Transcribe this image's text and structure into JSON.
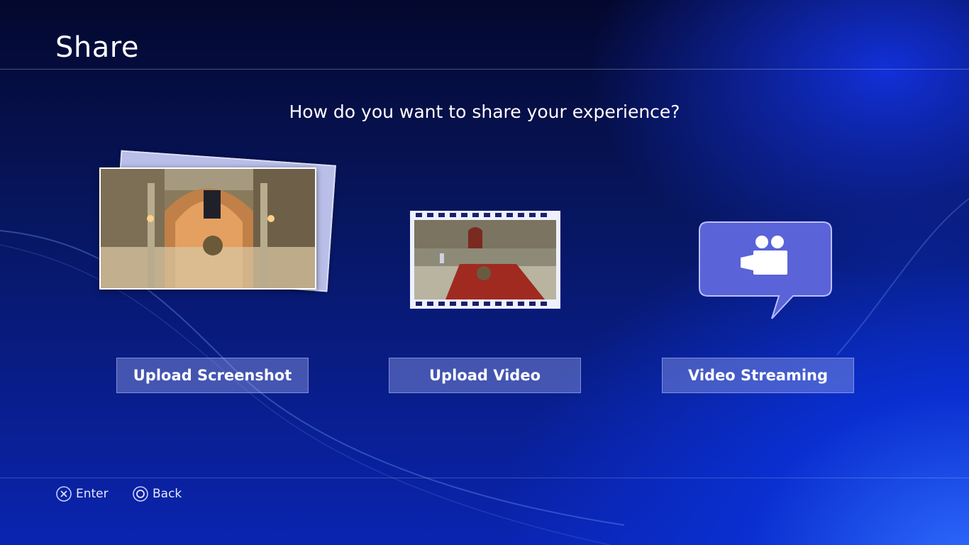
{
  "header": {
    "title": "Share"
  },
  "prompt": "How do you want to share your experience?",
  "options": [
    {
      "label": "Upload Screenshot",
      "icon": "screenshot-thumbnail"
    },
    {
      "label": "Upload Video",
      "icon": "video-film-thumbnail"
    },
    {
      "label": "Video Streaming",
      "icon": "video-camera-speech-bubble-icon"
    }
  ],
  "footer": {
    "enter": {
      "icon": "cross-button-icon",
      "label": "Enter"
    },
    "back": {
      "icon": "circle-button-icon",
      "label": "Back"
    }
  },
  "colors": {
    "background_dark": "#04082e",
    "background_blue": "#0a24b0",
    "button_fill": "#8a9be6",
    "bubble_fill": "#5a63d8"
  }
}
